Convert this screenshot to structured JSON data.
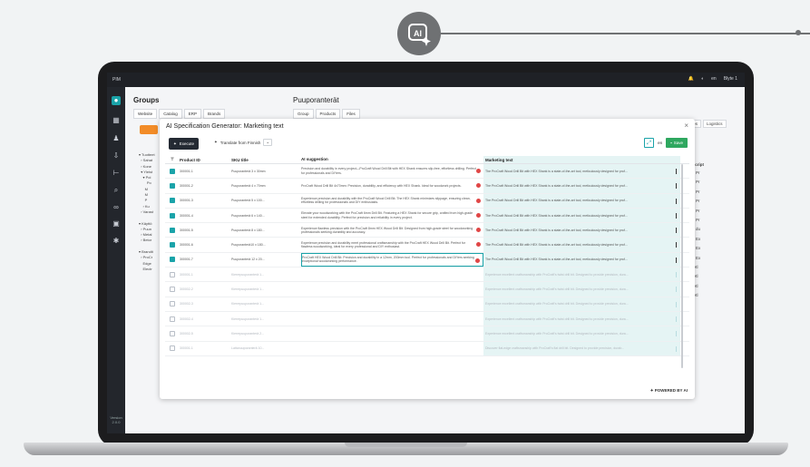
{
  "top": {
    "app_name": "PIM",
    "lang": "en",
    "user": "Blyte 1"
  },
  "sidebar": {
    "version_label": "Version 2.0.0"
  },
  "background": {
    "left_title": "Groups",
    "right_title": "Puuporanterät",
    "left_tabs": [
      "Website",
      "Catalog",
      "ERP",
      "Brands"
    ],
    "right_tabs": [
      "Group",
      "Products",
      "Files"
    ],
    "tree": [
      "▾ Tuotteet",
      "  › Sahat",
      "  › Kone",
      "  ▾ Yleist",
      "    ▾ Poi",
      "        Po",
      "      M",
      "      M",
      "      P",
      "    › Ku",
      "  › Varast",
      "",
      "▾ Käyttö",
      "  › Puun",
      "  › Metal",
      "  › Betor",
      "",
      "▾ Brandit",
      "  › ProCr",
      "    Edge",
      "    Electr"
    ],
    "right_tabs_extra": [
      "ces",
      "Logistics"
    ],
    "right_col_header": "Descript",
    "right_col_items": [
      "The Pr",
      "The Pr",
      "The Pr",
      "The Pr",
      "The Pr",
      "The Pr",
      "The du",
      "The Ex",
      "The Ex",
      "The Ex",
      "Whetl",
      "Whetl",
      "Whetl",
      "Whetl"
    ]
  },
  "modal": {
    "title": "AI Specification Generator: Marketing text",
    "execute_label": "Execute",
    "translate_label": "Translate from Finnish",
    "lang": "en",
    "save_label": "Save",
    "powered_label": "POWERED BY AI",
    "columns": [
      "Product ID",
      "SKU title",
      "AI suggestion",
      "Marketing text"
    ],
    "rows": [
      {
        "checked": true,
        "id": "300001-1",
        "sku": "Puuporanterä 3 x 30mm",
        "ai": "Precision and durability in every project—ProCraft Wood Drill Bit with HEX Shank ensures slip-free, effortless drilling. Perfect for professionals and DIYers.",
        "mkt": "The ProCraft Wood Drill Bit with HEX Shank is a state-of-the-art tool, meticulously designed for prof..."
      },
      {
        "checked": true,
        "id": "300001-2",
        "sku": "Puuporanterä 4 x 70mm",
        "ai": "ProCraft Wood Drill Bit 4x70mm: Precision, durability, and efficiency with HEX Shank. Ideal for woodwork projects.",
        "mkt": "The ProCraft Wood Drill Bit with HEX Shank is a state-of-the-art tool, meticulously designed for prof..."
      },
      {
        "checked": true,
        "id": "300001-3",
        "sku": "Puuporanterä 5 x 100...",
        "ai": "Experience precision and durability with the ProCraft Wood Drill Bit. The HEX Shank minimizes slippage, ensuring clean, effortless drilling for professionals and DIY enthusiasts.",
        "mkt": "The ProCraft Wood Drill Bit with HEX Shank is a state-of-the-art tool, meticulously designed for prof..."
      },
      {
        "checked": true,
        "id": "300001-4",
        "sku": "Puuporanterä 6 x 140...",
        "ai": "Elevate your woodworking with the ProCraft 6mm Drill Bit. Featuring a HEX Shank for secure grip, crafted from high-grade steel for extended durability. Perfect for precision and reliability in every project.",
        "mkt": "The ProCraft Wood Drill Bit with HEX Shank is a state-of-the-art tool, meticulously designed for prof..."
      },
      {
        "checked": true,
        "id": "300001-5",
        "sku": "Puuporanterä 8 x 180...",
        "ai": "Experience flawless precision with the ProCraft 8mm HEX Wood Drill Bit. Designed from high-grade steel for woodworking professionals seeking durability and accuracy.",
        "mkt": "The ProCraft Wood Drill Bit with HEX Shank is a state-of-the-art tool, meticulously designed for prof..."
      },
      {
        "checked": true,
        "id": "300001-6",
        "sku": "Puuporanterä10 x 180...",
        "ai": "Experience precision and durability meet professional craftsmanship with the ProCraft HEX Wood Drill Bit. Perfect for flawless woodworking, ideal for every professional and DIY enthusiast.",
        "mkt": "The ProCraft Wood Drill Bit with HEX Shank is a state-of-the-art tool, meticulously designed for prof..."
      },
      {
        "checked": true,
        "id": "300001-7",
        "sku": "Puuporanterä 12 x 20...",
        "ai": "ProCraft HEX Wood Drill Bit: Precision and durability in a 12mm, 200mm tool. Perfect for professionals and DIYers seeking exceptional woodworking performance.",
        "mkt": "The ProCraft Wood Drill Bit with HEX Shank is a state-of-the-art tool, meticulously designed for prof..."
      },
      {
        "checked": false,
        "id": "300001-1",
        "sku": "Kierrepuuporanterä 1...",
        "ai": "",
        "mkt": "Experience excellent craftsmanship with ProCraft's twist drill bit. Designed to provide precision, dura..."
      },
      {
        "checked": false,
        "id": "300002-2",
        "sku": "Kierrepuuporanterä 1...",
        "ai": "",
        "mkt": "Experience excellent craftsmanship with ProCraft's twist drill bit. Designed to provide precision, dura..."
      },
      {
        "checked": false,
        "id": "300002-3",
        "sku": "Kierrepuuporanterä 1...",
        "ai": "",
        "mkt": "Experience excellent craftsmanship with ProCraft's twist drill bit. Designed to provide precision, dura..."
      },
      {
        "checked": false,
        "id": "300002-4",
        "sku": "Kierrepuuporanterä 1...",
        "ai": "",
        "mkt": "Experience excellent craftsmanship with ProCraft's twist drill bit. Designed to provide precision, dura..."
      },
      {
        "checked": false,
        "id": "300002-5",
        "sku": "Kierrepuuporanterä 2...",
        "ai": "",
        "mkt": "Experience excellent craftsmanship with ProCraft's twist drill bit. Designed to provide precision, dura..."
      },
      {
        "checked": false,
        "id": "300001-1",
        "sku": "Lattanuuporanterä 10...",
        "ai": "",
        "mkt": "Discover flat-edge craftsmanship with ProCraft's flat drill bit. Designed to provide precision, durab..."
      }
    ]
  }
}
